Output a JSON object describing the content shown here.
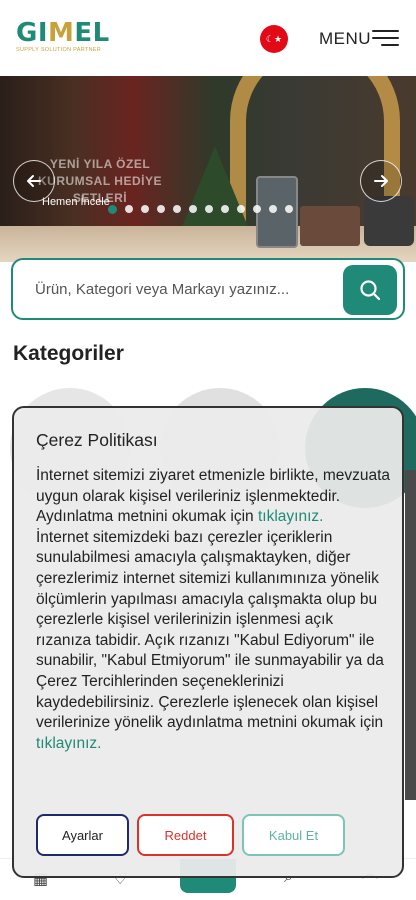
{
  "header": {
    "logo_main_left": "GI",
    "logo_main_gold": "M",
    "logo_main_right": "EL",
    "logo_sub": "SUPPLY SOLUTION PARTNER",
    "flag_symbol": "☾★",
    "menu_label": "MENU"
  },
  "hero": {
    "title_line1": "YENİ YILA ÖZEL",
    "title_line2": "KURUMSAL HEDİYE SETLERİ",
    "cta": "Hemen İncele",
    "prev_icon": "arrow-left-icon",
    "next_icon": "arrow-right-icon",
    "slide_count": 12,
    "active_slide": 1
  },
  "search": {
    "placeholder": "Ürün, Kategori veya Markayı yazınız..."
  },
  "categories": {
    "title": "Kategoriler"
  },
  "cookie_modal": {
    "title": "Çerez Politikası",
    "para1": "İnternet sitemizi ziyaret etmenizle birlikte, mevzuata uygun olarak kişisel verileriniz işlenmektedir. Aydınlatma metnini okumak için",
    "link1": "tıklayınız.",
    "para2": "İnternet sitemizdeki bazı çerezler içeriklerin sunulabilmesi amacıyla çalışmaktayken, diğer çerezlerimiz internet sitemizi kullanımınıza yönelik ölçümlerin yapılması amacıyla çalışmakta olup bu çerezlerle kişisel verilerinizin işlenmesi açık rızanıza tabidir. Açık rızanızı \"Kabul Ediyorum\" ile sunabilir, \"Kabul Etmiyorum\" ile sunmayabilir ya da Çerez Tercihlerinden seçeneklerinizi kaydedebilirsiniz. Çerezlerle işlenecek olan kişisel verilerinize yönelik aydınlatma metnini okumak için",
    "link2": "tıklayınız.",
    "buttons": {
      "settings": "Ayarlar",
      "reject": "Reddet",
      "accept": "Kabul Et"
    }
  },
  "colors": {
    "brand": "#1f8a78",
    "gold": "#c7a23a",
    "reject": "#d9332a",
    "settings_border": "#1f2a6a"
  }
}
